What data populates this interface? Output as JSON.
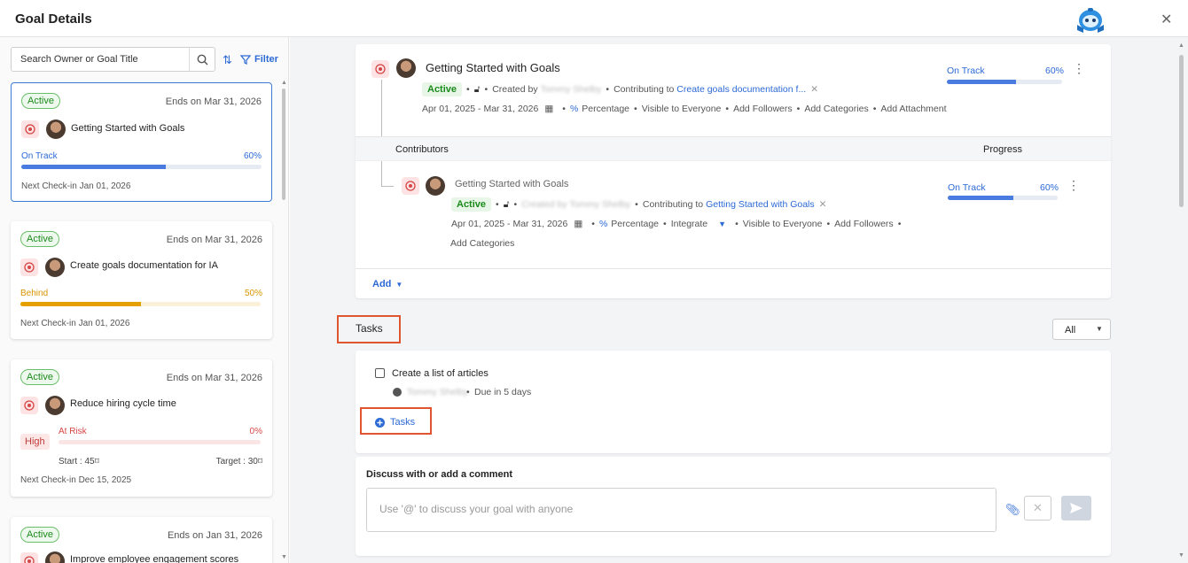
{
  "header": {
    "title": "Goal Details"
  },
  "sidebar": {
    "search_placeholder": "Search Owner or Goal Title",
    "filter_label": "Filter",
    "cards": [
      {
        "status_badge": "Active",
        "ends": "Ends on Mar 31, 2026",
        "title": "Getting Started with Goals",
        "progress_label": "On Track",
        "progress_pct": "60%",
        "progress": 0.6,
        "checkin": "Next Check-in Jan 01, 2026"
      },
      {
        "status_badge": "Active",
        "ends": "Ends on Mar 31, 2026",
        "title": "Create goals documentation for IA",
        "progress_label": "Behind",
        "progress_pct": "50%",
        "progress": 0.5,
        "checkin": "Next Check-in Jan 01, 2026"
      },
      {
        "status_badge": "Active",
        "ends": "Ends on Mar 31, 2026",
        "title": "Reduce hiring cycle time",
        "priority": "High",
        "progress_label": "At Risk",
        "progress_pct": "0%",
        "progress": 0,
        "start": "Start : 45",
        "target": "Target : 30",
        "checkin": "Next Check-in Dec 15, 2025"
      },
      {
        "status_badge": "Active",
        "ends": "Ends on Jan 31, 2026",
        "title": "Improve employee engagement scores"
      }
    ]
  },
  "goal": {
    "title": "Getting Started with Goals",
    "status": "Active",
    "created_by_label": "Created by",
    "created_by": "Tommy Shelby",
    "contributing_label": "Contributing to",
    "contributing_to": "Create goals documentation f...",
    "dates": "Apr 01, 2025 - Mar 31, 2026",
    "metric": "Percentage",
    "visibility": "Visible to Everyone",
    "add_followers": "Add Followers",
    "add_categories": "Add Categories",
    "add_attachment": "Add Attachment",
    "progress_label": "On Track",
    "progress_pct": "60%",
    "progress": 0.6
  },
  "contributors": {
    "header": "Contributors",
    "progress_header": "Progress",
    "item": {
      "title": "Getting Started with Goals",
      "status": "Active",
      "created_by": "Created by Tommy Shelby",
      "contributing_label": "Contributing to",
      "contributing_to": "Getting Started with Goals",
      "dates": "Apr 01, 2025 - Mar 31, 2026",
      "metric": "Percentage",
      "integrate": "Integrate",
      "visibility": "Visible to Everyone",
      "add_followers": "Add Followers",
      "add_categories": "Add Categories",
      "progress_label": "On Track",
      "progress_pct": "60%",
      "progress": 0.6
    },
    "add_label": "Add"
  },
  "tasks": {
    "title": "Tasks",
    "filter_value": "All",
    "items": [
      {
        "title": "Create a list of articles",
        "owner": "Tommy Shelby",
        "due": "Due in 5 days"
      }
    ],
    "add_label": "Tasks"
  },
  "comment": {
    "title": "Discuss with or add a comment",
    "placeholder": "Use '@' to discuss your goal with anyone"
  },
  "colors": {
    "accent": "#2c6ad6",
    "on_track": "#4a7be0",
    "behind": "#e5a000",
    "at_risk": "#d64545",
    "active": "#1c8a1c",
    "highlight": "#e0552f"
  }
}
